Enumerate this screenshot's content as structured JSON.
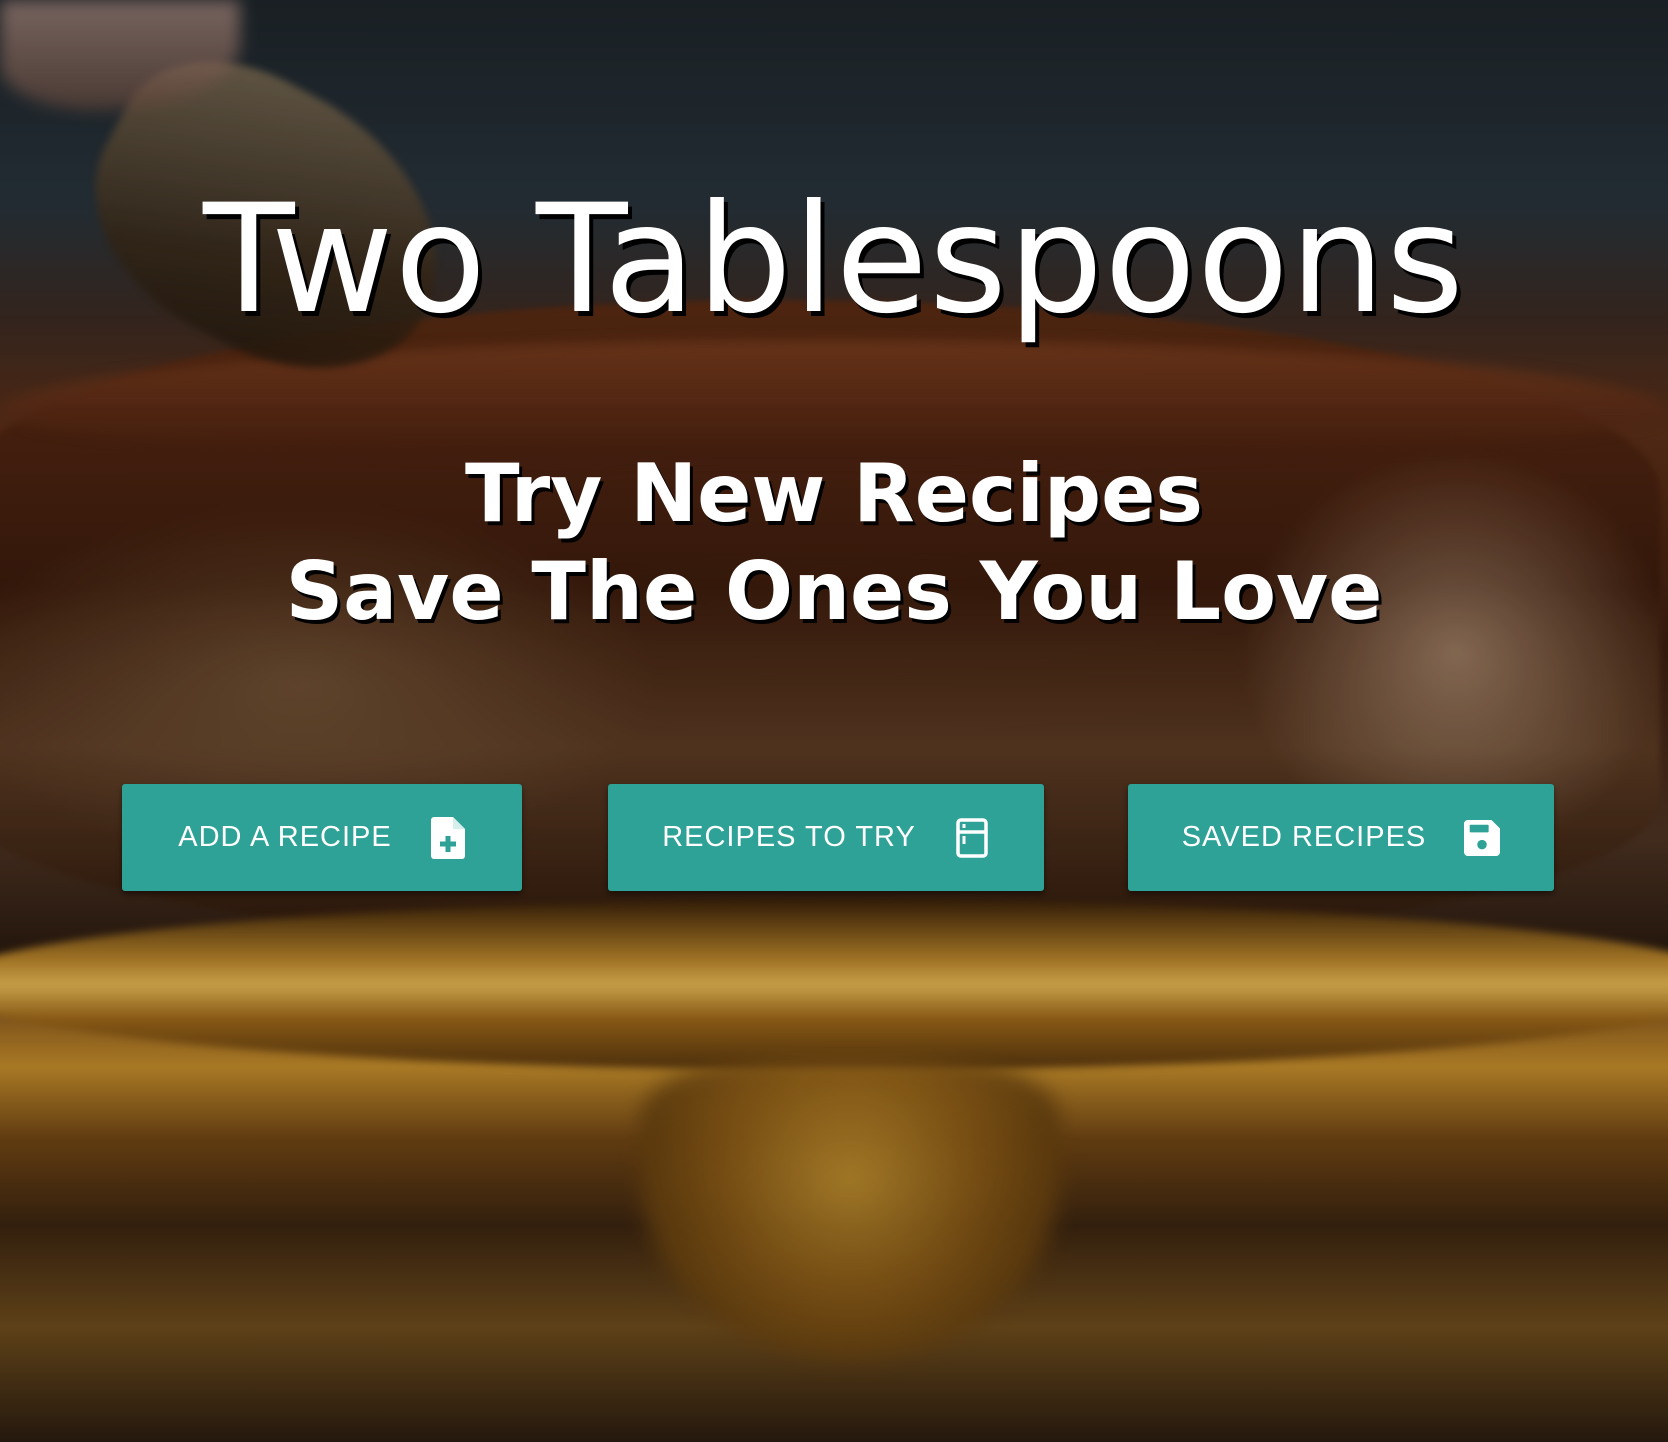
{
  "hero": {
    "title": "Two Tablespoons",
    "tagline_line1": "Try New Recipes",
    "tagline_line2": "Save The Ones You Love"
  },
  "buttons": [
    {
      "label": "ADD A RECIPE",
      "icon": "file-add-icon"
    },
    {
      "label": "RECIPES TO TRY",
      "icon": "kitchen-fridge-icon"
    },
    {
      "label": "SAVED RECIPES",
      "icon": "floppy-disk-save-icon"
    }
  ],
  "colors": {
    "button_bg": "#2ea296",
    "text": "#ffffff",
    "text_shadow": "#000000"
  }
}
